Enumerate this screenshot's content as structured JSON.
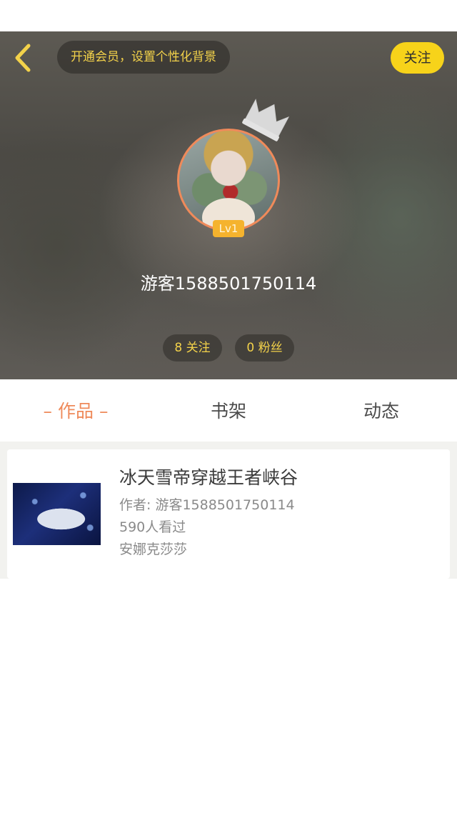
{
  "header": {
    "vip_banner": "开通会员，设置个性化背景",
    "follow_label": "关注",
    "username": "游客1588501750114",
    "level": "Lv1",
    "stats": {
      "following": "8 关注",
      "fans": "0 粉丝"
    }
  },
  "icons": {
    "back": "chevron-left-icon",
    "crown": "crown-icon"
  },
  "colors": {
    "accent": "#f7d31a",
    "active_tab": "#ef8a5a",
    "banner_text": "#f3d24a"
  },
  "tabs": [
    {
      "label": "– 作品 –",
      "active": true
    },
    {
      "label": "书架",
      "active": false
    },
    {
      "label": "动态",
      "active": false
    }
  ],
  "works": [
    {
      "title": "冰天雪帝穿越王者峡谷",
      "author": "作者: 游客1588501750114",
      "views": "590人看过",
      "tag": "安娜克莎莎"
    }
  ]
}
